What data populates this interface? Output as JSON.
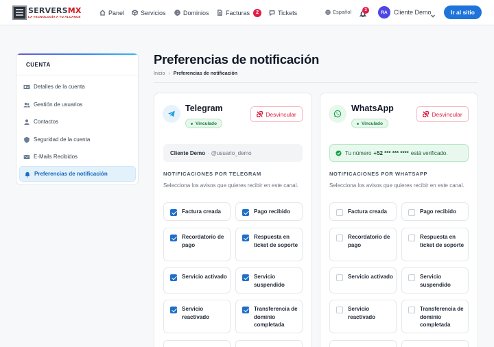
{
  "brand": {
    "name_a": "SERVERS",
    "name_b": "MX",
    "tagline": "LA TECNOLOGÍA A TU ALCANCE"
  },
  "nav": {
    "items": [
      {
        "label": "Panel",
        "icon": "home-icon"
      },
      {
        "label": "Servicios",
        "icon": "box-icon"
      },
      {
        "label": "Dominios",
        "icon": "globe-icon"
      },
      {
        "label": "Facturas",
        "icon": "file-icon",
        "badge": "2"
      },
      {
        "label": "Tickets",
        "icon": "chat-icon"
      }
    ],
    "language": "Español",
    "notifications_count": "3",
    "user_initials": "RA",
    "user_name": "Cliente Demo",
    "site_button": "Ir al sitio"
  },
  "sidebar": {
    "title": "CUENTA",
    "items": [
      {
        "label": "Detalles de la cuenta",
        "icon": "id-card-icon"
      },
      {
        "label": "Gestión de usuarios",
        "icon": "users-icon"
      },
      {
        "label": "Contactos",
        "icon": "contact-icon"
      },
      {
        "label": "Seguridad de la cuenta",
        "icon": "shield-icon"
      },
      {
        "label": "E-Mails Recibidos",
        "icon": "mail-icon"
      },
      {
        "label": "Preferencias de notificación",
        "icon": "bell-icon",
        "active": true
      }
    ]
  },
  "page": {
    "title": "Preferencias de notificación",
    "breadcrumb_home": "Inicio",
    "breadcrumb_current": "Preferencias de notificación"
  },
  "telegram": {
    "name": "Telegram",
    "status": "Vinculado",
    "unlink_label": "Desvincular",
    "account_name": "Cliente Demo",
    "account_handle": "@usuario_demo",
    "section_title": "NOTIFICACIONES POR TELEGRAM",
    "section_desc": "Selecciona los avisos que quieres recibir en este canal.",
    "options": [
      {
        "label": "Factura creada",
        "checked": true
      },
      {
        "label": "Pago recibido",
        "checked": true
      },
      {
        "label": "Recordatorio de pago",
        "checked": true
      },
      {
        "label": "Respuesta en ticket de soporte",
        "checked": true
      },
      {
        "label": "Servicio activado",
        "checked": true
      },
      {
        "label": "Servicio suspendido",
        "checked": true
      },
      {
        "label": "Servicio reactivado",
        "checked": true
      },
      {
        "label": "Transferencia de dominio completada",
        "checked": true
      }
    ]
  },
  "whatsapp": {
    "name": "WhatsApp",
    "status": "Vinculado",
    "unlink_label": "Desvincular",
    "verified_prefix": "Tu número",
    "verified_number": "+52 *** *** ****",
    "verified_suffix": "está verificado.",
    "section_title": "NOTIFICACIONES POR WHATSAPP",
    "section_desc": "Selecciona los avisos que quieres recibir en este canal.",
    "options": [
      {
        "label": "Factura creada",
        "checked": false
      },
      {
        "label": "Pago recibido",
        "checked": false
      },
      {
        "label": "Recordatorio de pago",
        "checked": false
      },
      {
        "label": "Respuesta en ticket de soporte",
        "checked": false
      },
      {
        "label": "Servicio activado",
        "checked": false
      },
      {
        "label": "Servicio suspendido",
        "checked": false
      },
      {
        "label": "Servicio reactivado",
        "checked": false
      },
      {
        "label": "Transferencia de dominio completada",
        "checked": false
      }
    ]
  },
  "colors": {
    "primary": "#1e74d8",
    "active_bg": "#e3f1fb",
    "success": "#16a34a",
    "danger": "#dc2040"
  }
}
